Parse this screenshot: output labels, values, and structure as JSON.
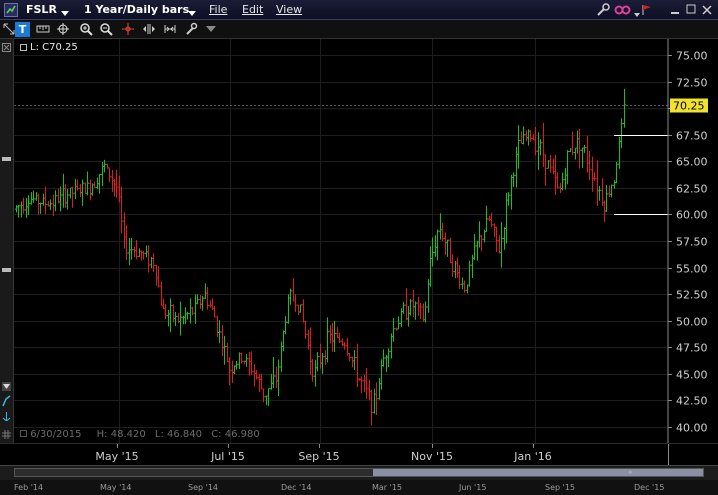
{
  "titlebar": {
    "symbol": "FSLR",
    "timeframe": "1 Year/Daily bars",
    "menus": [
      "File",
      "Edit",
      "View"
    ]
  },
  "toolbar": {
    "text_tool": "T"
  },
  "chart": {
    "last_label": "L: C70.25",
    "current_price": "70.25",
    "ohlc_date": "6/30/2015",
    "ohlc_high": "H: 48.420",
    "ohlc_low": "L: 46.840",
    "ohlc_close": "C: 46.980",
    "colors": {
      "up": "#19c019",
      "down": "#e01b1b",
      "price_tag": "#f2e230",
      "axis": "#cfcfcf"
    }
  },
  "chart_data": {
    "type": "candlestick",
    "y_ticks": [
      "75.00",
      "72.50",
      "70.00",
      "67.50",
      "65.00",
      "62.50",
      "60.00",
      "57.50",
      "55.00",
      "52.50",
      "50.00",
      "47.50",
      "45.00",
      "42.50",
      "40.00"
    ],
    "ylim": [
      38.5,
      76.5
    ],
    "x_labels": [
      "May '15",
      "Jul '15",
      "Sep '15",
      "Nov '15",
      "Jan '16"
    ],
    "price_markers": [
      67.5,
      60.0
    ],
    "anchors": [
      [
        0,
        60.5
      ],
      [
        15,
        61.5
      ],
      [
        35,
        61.0
      ],
      [
        55,
        62.0
      ],
      [
        75,
        62.5
      ],
      [
        90,
        64.5
      ],
      [
        103,
        62.5
      ],
      [
        110,
        57.0
      ],
      [
        125,
        56.5
      ],
      [
        140,
        55.5
      ],
      [
        148,
        51.0
      ],
      [
        165,
        50.0
      ],
      [
        180,
        51.0
      ],
      [
        190,
        52.5
      ],
      [
        200,
        50.5
      ],
      [
        215,
        45.5
      ],
      [
        228,
        46.5
      ],
      [
        238,
        45.5
      ],
      [
        250,
        43.0
      ],
      [
        262,
        44.5
      ],
      [
        275,
        52.5
      ],
      [
        285,
        51.5
      ],
      [
        295,
        47.0
      ],
      [
        300,
        45.0
      ],
      [
        315,
        48.5
      ],
      [
        330,
        48.0
      ],
      [
        345,
        44.5
      ],
      [
        360,
        42.0
      ],
      [
        368,
        46.0
      ],
      [
        378,
        49.0
      ],
      [
        390,
        51.0
      ],
      [
        400,
        51.5
      ],
      [
        410,
        50.0
      ],
      [
        415,
        55.0
      ],
      [
        425,
        59.0
      ],
      [
        440,
        55.0
      ],
      [
        450,
        53.0
      ],
      [
        462,
        57.0
      ],
      [
        475,
        59.5
      ],
      [
        485,
        56.5
      ],
      [
        495,
        62.5
      ],
      [
        505,
        66.5
      ],
      [
        515,
        67.5
      ],
      [
        525,
        66.5
      ],
      [
        535,
        64.5
      ],
      [
        545,
        62.0
      ],
      [
        555,
        66.0
      ],
      [
        565,
        67.0
      ],
      [
        578,
        64.0
      ],
      [
        590,
        61.0
      ],
      [
        600,
        63.5
      ],
      [
        610,
        70.0
      ],
      [
        615,
        71.5
      ],
      [
        619,
        71.0
      ]
    ]
  },
  "timebar_labels": [],
  "navigator": {
    "labels": [
      "Feb '14",
      "May '14",
      "Sep '14",
      "Dec '14",
      "Mar '15",
      "Jun '15",
      "Sep '15",
      "Dec '15"
    ]
  }
}
